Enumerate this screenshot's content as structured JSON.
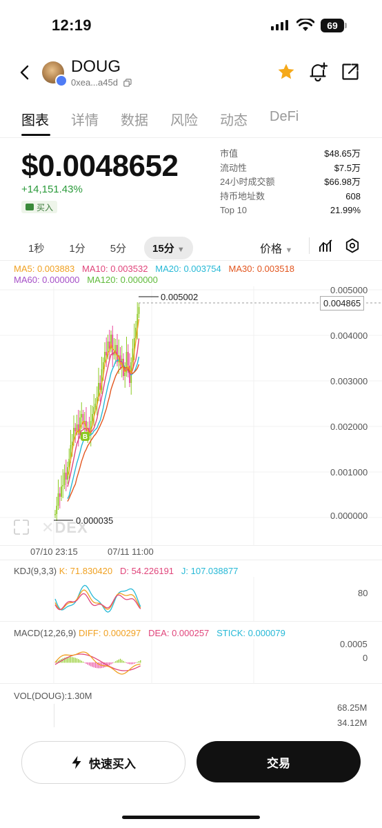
{
  "status_bar": {
    "time": "12:19",
    "battery": "69"
  },
  "header": {
    "token_name": "DOUG",
    "address": "0xea...a45d"
  },
  "tabs": [
    "图表",
    "详情",
    "数据",
    "风险",
    "动态",
    "DeFi"
  ],
  "price": {
    "value": "$0.0048652",
    "change": "+14,151.43%",
    "buy_tag": "买入"
  },
  "stats": [
    {
      "label": "市值",
      "value": "$48.65万"
    },
    {
      "label": "流动性",
      "value": "$7.5万"
    },
    {
      "label": "24小时成交额",
      "value": "$66.98万"
    },
    {
      "label": "持币地址数",
      "value": "608"
    },
    {
      "label": "Top 10",
      "value": "21.99%"
    }
  ],
  "intervals": [
    "1秒",
    "1分",
    "5分",
    "15分"
  ],
  "active_interval": "15分",
  "price_mode": "价格",
  "ma_legend": {
    "ma5": "MA5: 0.003883",
    "ma10": "MA10: 0.003532",
    "ma20": "MA20: 0.003754",
    "ma30": "MA30: 0.003518",
    "ma60": "MA60: 0.000000",
    "ma120": "MA120: 0.000000"
  },
  "colors": {
    "ma5": "#f0a020",
    "ma10": "#e0447a",
    "ma20": "#25b8d6",
    "ma30": "#e2551e",
    "ma60": "#a54ec7",
    "ma120": "#5fba3a",
    "up": "#8cc820",
    "down": "#e8449a"
  },
  "chart": {
    "y_axis": [
      "0.005000",
      "0.004000",
      "0.003000",
      "0.002000",
      "0.001000",
      "0.000000"
    ],
    "current_price_tag": "0.004865",
    "high_label": "0.005002",
    "low_label": "0.000035",
    "x_axis": [
      "07/10 23:15",
      "07/11 11:00"
    ],
    "watermark": "DEX",
    "buy_marker": "B"
  },
  "kdj": {
    "title": "KDJ(9,3,3)",
    "k": "K: 71.830420",
    "d": "D: 54.226191",
    "j": "J: 107.038877",
    "axis": "80"
  },
  "macd": {
    "title": "MACD(12,26,9)",
    "diff": "DIFF: 0.000297",
    "dea": "DEA: 0.000257",
    "stick": "STICK: 0.000079",
    "axis_top": "0.0005",
    "axis_zero": "0"
  },
  "vol": {
    "title": "VOL(DOUG):1.30M",
    "axis_top": "68.25M",
    "axis_mid": "34.12M"
  },
  "buttons": {
    "quick_buy": "快速买入",
    "trade": "交易"
  }
}
